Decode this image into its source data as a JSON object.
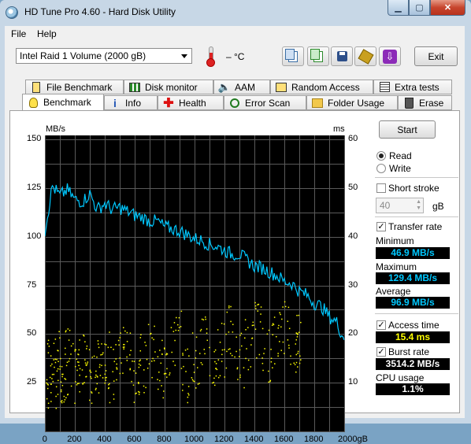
{
  "window": {
    "title": "HD Tune Pro 4.60 - Hard Disk Utility"
  },
  "menu": {
    "file": "File",
    "help": "Help"
  },
  "toolbar": {
    "drive": "Intel   Raid 1 Volume (2000 gB)",
    "temperature": "– °C",
    "exit_label": "Exit"
  },
  "tabs": {
    "row1": [
      "File Benchmark",
      "Disk monitor",
      "AAM",
      "Random Access",
      "Extra tests"
    ],
    "row2": [
      "Benchmark",
      "Info",
      "Health",
      "Error Scan",
      "Folder Usage",
      "Erase"
    ]
  },
  "panel": {
    "start_label": "Start",
    "read_label": "Read",
    "write_label": "Write",
    "short_stroke_label": "Short stroke",
    "short_stroke_value": "40",
    "short_stroke_unit": "gB",
    "transfer_rate_label": "Transfer rate",
    "minimum_label": "Minimum",
    "minimum_value": "46.9 MB/s",
    "maximum_label": "Maximum",
    "maximum_value": "129.4 MB/s",
    "average_label": "Average",
    "average_value": "96.9 MB/s",
    "access_time_label": "Access time",
    "access_time_value": "15.4 ms",
    "burst_rate_label": "Burst rate",
    "burst_rate_value": "3514.2 MB/s",
    "cpu_usage_label": "CPU usage",
    "cpu_usage_value": "1.1%",
    "transfer_color": "#00c8ff",
    "burst_color": "#ffffff",
    "access_color": "#ffff00"
  },
  "chart_data": {
    "type": "line",
    "ylabel": "MB/s",
    "y2label": "ms",
    "xlabel_unit": "gB",
    "ylim": [
      0,
      150
    ],
    "y2lim": [
      0,
      60
    ],
    "xlim": [
      0,
      2000
    ],
    "y_ticks": [
      "150",
      "125",
      "100",
      "75",
      "50",
      "25"
    ],
    "y2_ticks": [
      "60",
      "50",
      "40",
      "30",
      "20",
      "10"
    ],
    "x_ticks": [
      "0",
      "200",
      "400",
      "600",
      "800",
      "1000",
      "1200",
      "1400",
      "1600",
      "1800",
      "2000gB"
    ],
    "grid": true,
    "series": [
      {
        "name": "Transfer rate",
        "x": [
          0,
          50,
          100,
          150,
          200,
          250,
          300,
          350,
          400,
          450,
          500,
          550,
          600,
          650,
          700,
          750,
          800,
          850,
          900,
          950,
          1000,
          1050,
          1100,
          1150,
          1200,
          1250,
          1300,
          1350,
          1400,
          1450,
          1500,
          1550,
          1600,
          1650,
          1700,
          1750,
          1800,
          1850,
          1900,
          1950,
          2000
        ],
        "values": [
          103,
          126,
          121,
          124,
          119,
          118,
          122,
          114,
          117,
          114,
          115,
          113,
          111,
          110,
          108,
          108,
          105,
          104,
          103,
          101,
          99,
          98,
          96,
          95,
          93,
          91,
          91,
          88,
          85,
          84,
          82,
          80,
          77,
          76,
          72,
          70,
          66,
          64,
          59,
          56,
          47
        ]
      }
    ],
    "access_time_ms": {
      "x": [
        10,
        40,
        70,
        100,
        130,
        160,
        200,
        240,
        280,
        320,
        360,
        400,
        450,
        500,
        550,
        600,
        650,
        700,
        760,
        820,
        880,
        940,
        1000,
        1060,
        1120,
        1180,
        1240,
        1300,
        1360,
        1420,
        1480,
        1540,
        1600,
        1660,
        1700
      ],
      "values": [
        10,
        13,
        15,
        9,
        12,
        16,
        11,
        14,
        17,
        10,
        13,
        16,
        12,
        15,
        18,
        11,
        14,
        17,
        13,
        16,
        19,
        12,
        15,
        18,
        14,
        17,
        20,
        15,
        18,
        21,
        16,
        19,
        22,
        17,
        20
      ]
    }
  }
}
